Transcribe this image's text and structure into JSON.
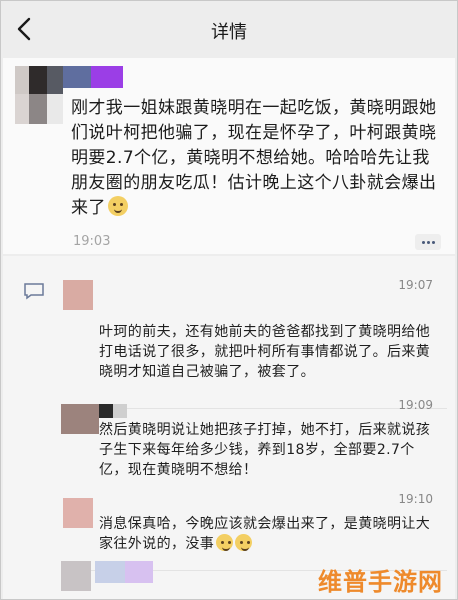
{
  "header": {
    "title": "详情",
    "back_icon": "chevron-left-icon"
  },
  "post": {
    "text": "刚才我一姐妹跟黄晓明在一起吃饭，黄晓明跟她们说叶柯把他骗了，现在是怀孕了，叶柯跟黄晓明要2.7个亿，黄晓明不想给她。哈哈哈先让我朋友圈的朋友吃瓜！估计晚上这个八卦就会爆出来了",
    "emoji": "grinning-emoji",
    "time": "19:03",
    "more_icon": "more-dots-icon"
  },
  "comments": [
    {
      "time": "19:07",
      "text": "叶珂的前夫，还有她前夫的爸爸都找到了黄晓明给他打电话说了很多，就把叶柯所有事情都说了。后来黄晓明才知道自己被骗了，被套了。"
    },
    {
      "time": "19:09",
      "text": "然后黄晓明说让她把孩子打掉，她不打，后来就说孩子生下来每年给多少钱，养到18岁，全部要2.7个亿，现在黄晓明不想给！"
    },
    {
      "time": "19:10",
      "text": "消息保真哈，今晚应该就会爆出来了，是黄晓明让大家往外说的，没事",
      "emoji_count": 2
    }
  ],
  "comment_icon": "comment-bubble-icon",
  "watermark": "维普手游网",
  "colors": {
    "background": "#ededed",
    "card": "#fafafa",
    "time": "#a4a4a4",
    "watermark": "#ee8a2c"
  }
}
